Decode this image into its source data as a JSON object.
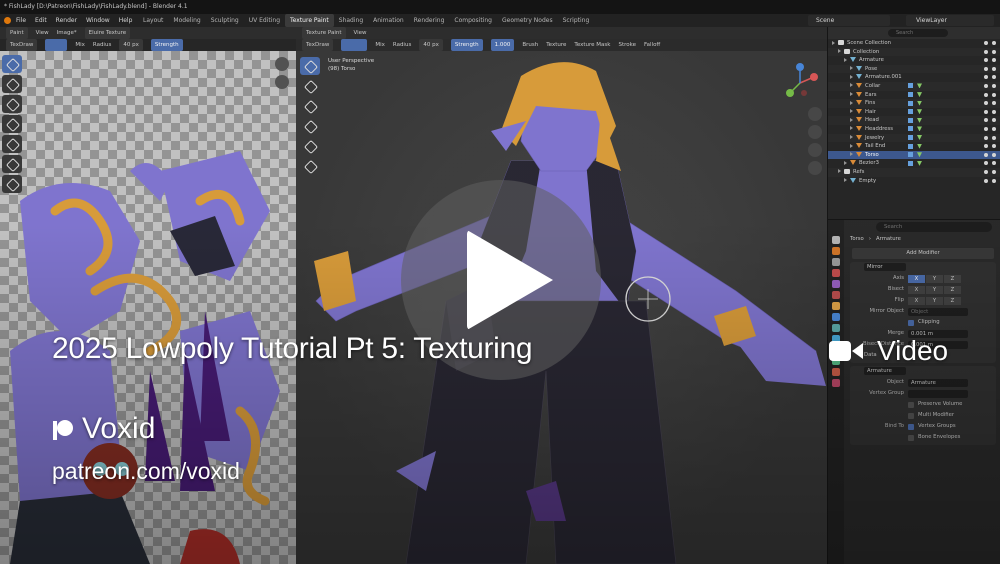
{
  "window": {
    "title": "* FishLady [D:\\Patreon\\FishLady\\FishLady.blend] - Blender 4.1"
  },
  "menubar": {
    "menus": [
      "File",
      "Edit",
      "Render",
      "Window",
      "Help"
    ],
    "workspaces": [
      "Layout",
      "Modeling",
      "Sculpting",
      "UV Editing",
      "Texture Paint",
      "Shading",
      "Animation",
      "Rendering",
      "Compositing",
      "Geometry Nodes",
      "Scripting"
    ],
    "active_workspace": "Texture Paint",
    "scene": "Scene",
    "view_layer": "ViewLayer"
  },
  "image_editor": {
    "header": [
      "Paint",
      "View",
      "Image*"
    ],
    "image_name": "Eluire Texture",
    "brush": "TexDraw",
    "blend": "Mix",
    "radius_label": "Radius",
    "radius_value": "40 px",
    "strength_label": "Strength"
  },
  "viewport": {
    "mode": "Texture Paint",
    "view_menu": "View",
    "brush": "TexDraw",
    "blend": "Mix",
    "radius_label": "Radius",
    "radius_value": "40 px",
    "strength_label": "Strength",
    "strength_value": "1.000",
    "menus": [
      "Brush",
      "Texture",
      "Texture Mask",
      "Stroke",
      "Falloff"
    ],
    "texture_slot": "Eluire Texture",
    "info_line1": "User Perspective",
    "info_line2": "(98) Torso"
  },
  "outliner": {
    "search_placeholder": "Search",
    "rows": [
      {
        "label": "Scene Collection",
        "type": "col",
        "depth": 0
      },
      {
        "label": "Collection",
        "type": "col",
        "depth": 1
      },
      {
        "label": "Armature",
        "type": "arm",
        "depth": 2
      },
      {
        "label": "Pose",
        "type": "arm",
        "depth": 3
      },
      {
        "label": "Armature.001",
        "type": "arm",
        "depth": 3
      },
      {
        "label": "Collar",
        "type": "mesh",
        "depth": 3
      },
      {
        "label": "Ears",
        "type": "mesh",
        "depth": 3
      },
      {
        "label": "Fins",
        "type": "mesh",
        "depth": 3
      },
      {
        "label": "Hair",
        "type": "mesh",
        "depth": 3
      },
      {
        "label": "Head",
        "type": "mesh",
        "depth": 3
      },
      {
        "label": "Headdress",
        "type": "mesh",
        "depth": 3
      },
      {
        "label": "Jewelry",
        "type": "mesh",
        "depth": 3
      },
      {
        "label": "Tail End",
        "type": "mesh",
        "depth": 3
      },
      {
        "label": "Torso",
        "type": "mesh",
        "depth": 3,
        "selected": true
      },
      {
        "label": "Bezier3",
        "type": "mesh",
        "depth": 2
      },
      {
        "label": "Refs",
        "type": "col",
        "depth": 1
      },
      {
        "label": "Empty",
        "type": "arm",
        "depth": 2
      }
    ]
  },
  "properties": {
    "search_placeholder": "Search",
    "object": "Torso",
    "armature": "Armature",
    "add_modifier": "Add Modifier",
    "mirror": {
      "name": "Mirror",
      "axis_label": "Axis",
      "bisect_label": "Bisect",
      "flip_label": "Flip",
      "axes": [
        "X",
        "Y",
        "Z"
      ],
      "mirror_object_label": "Mirror Object",
      "mirror_object_placeholder": "Object",
      "clipping_label": "Clipping",
      "merge_label": "Merge",
      "merge_value": "0.001 m",
      "bisect_distance_label": "Bisect Distance",
      "bisect_distance_value": "0.001 m",
      "data_label": "Data"
    },
    "armature_mod": {
      "name": "Armature",
      "object_label": "Object",
      "object_value": "Armature",
      "vertex_group_label": "Vertex Group",
      "preserve_volume": "Preserve Volume",
      "multi_modifier": "Multi Modifier",
      "bind_to_label": "Bind To",
      "vertex_groups": "Vertex Groups",
      "bone_envelopes": "Bone Envelopes"
    }
  },
  "overlay": {
    "video_title": "2025 Lowpoly Tutorial Pt 5: Texturing",
    "video_label": "Video",
    "creator": "Voxid",
    "creator_url": "patreon.com/voxid"
  },
  "colors": {
    "accent": "#4d6fb0",
    "mesh_purple": "#8479d6",
    "hair_gold": "#e0a13c",
    "brand_orange": "#e87d0d"
  }
}
